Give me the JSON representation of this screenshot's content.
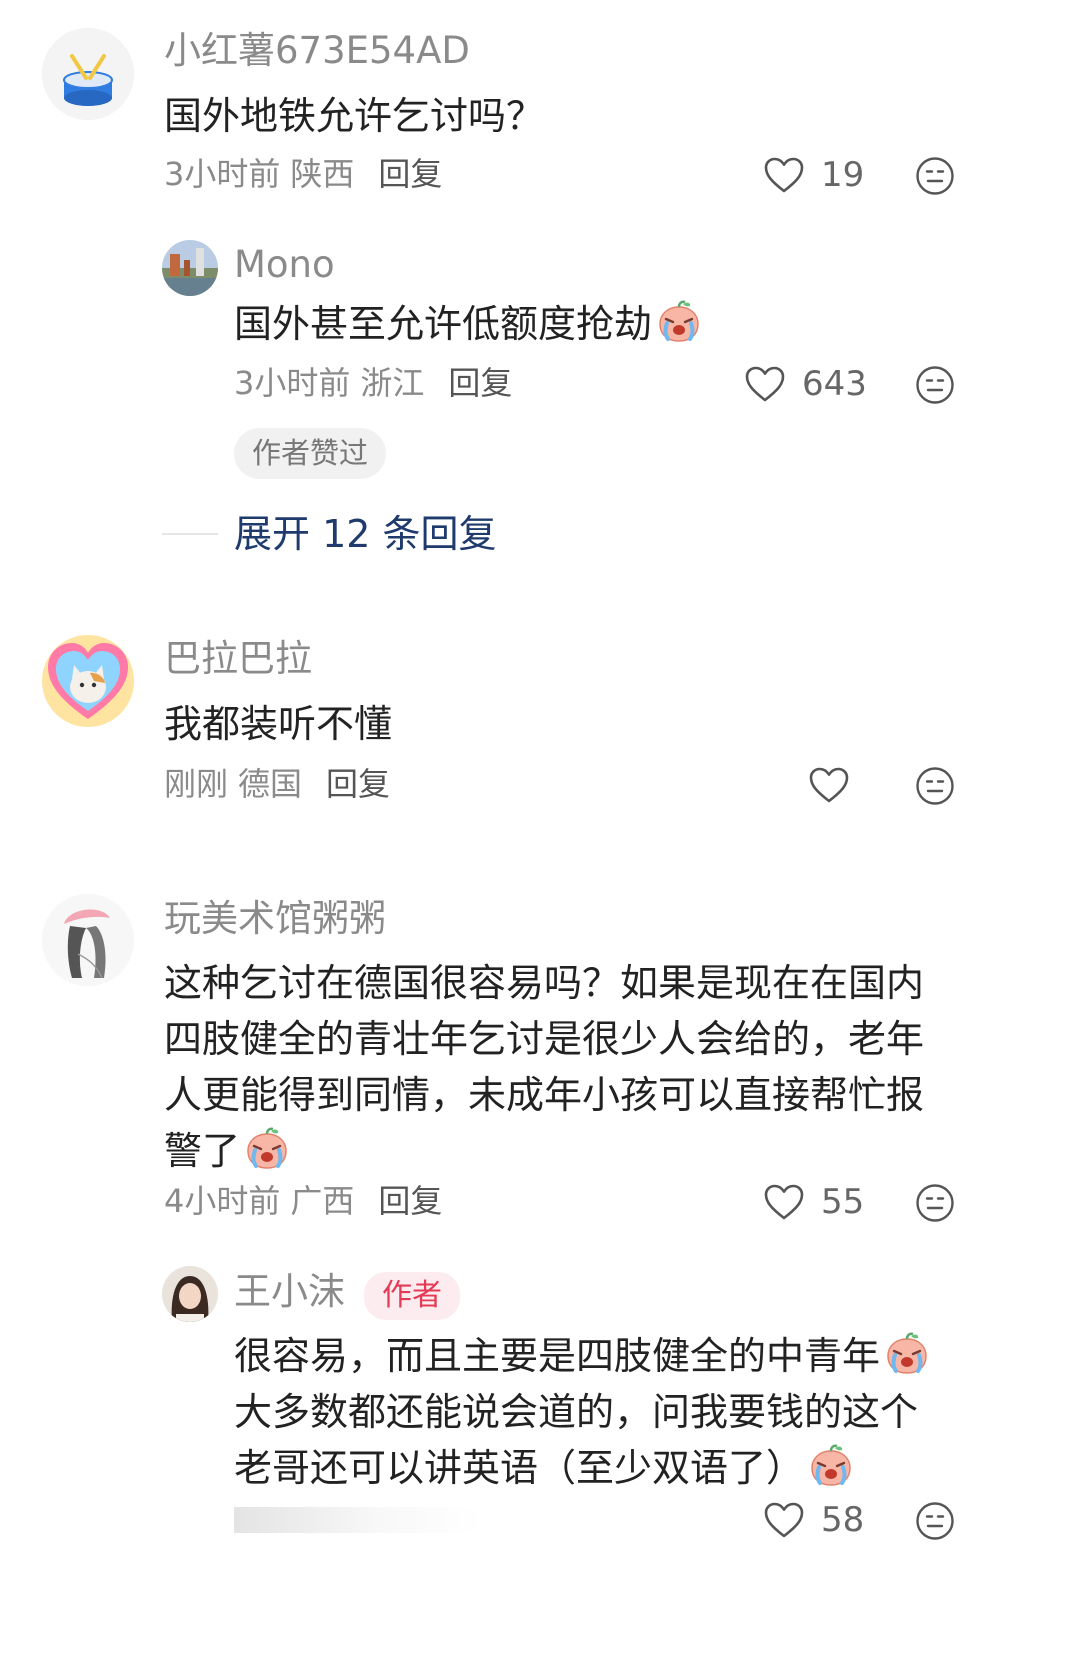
{
  "comments": [
    {
      "username": "小红薯673E54AD",
      "text": "国外地铁允许乞讨吗？",
      "time": "3小时前",
      "location": "陕西",
      "reply_label": "回复",
      "likes": "19",
      "replies": [
        {
          "username": "Mono",
          "text": "国外甚至允许低额度抢劫",
          "time": "3小时前",
          "location": "浙江",
          "reply_label": "回复",
          "likes": "643",
          "chip": "作者赞过"
        }
      ],
      "expand_label": "展开 12 条回复"
    },
    {
      "username": "巴拉巴拉",
      "text": "我都装听不懂",
      "time": "刚刚",
      "location": "德国",
      "reply_label": "回复",
      "likes": ""
    },
    {
      "username": "玩美术馆粥粥",
      "text": "这种乞讨在德国很容易吗？如果是现在在国内四肢健全的青壮年乞讨是很少人会给的，老年人更能得到同情，未成年小孩可以直接帮忙报警了",
      "time": "4小时前",
      "location": "广西",
      "reply_label": "回复",
      "likes": "55",
      "replies": [
        {
          "username": "王小沫",
          "badge": "作者",
          "text_line1": "很容易，而且主要是四肢健全的中青年",
          "text_line2": "大多数都还能说会道的，问我要钱的这个",
          "text_line3": "老哥还可以讲英语（至少双语了）",
          "likes": "58"
        }
      ]
    }
  ],
  "icons": {
    "like": "heart-outline-icon",
    "emoji": "neutral-face-icon",
    "crying_emoji": "crying-peach-emoji"
  },
  "colors": {
    "author_badge": "#e33a55",
    "expand_link": "#1f3a6d",
    "muted": "#8a8a8a"
  }
}
